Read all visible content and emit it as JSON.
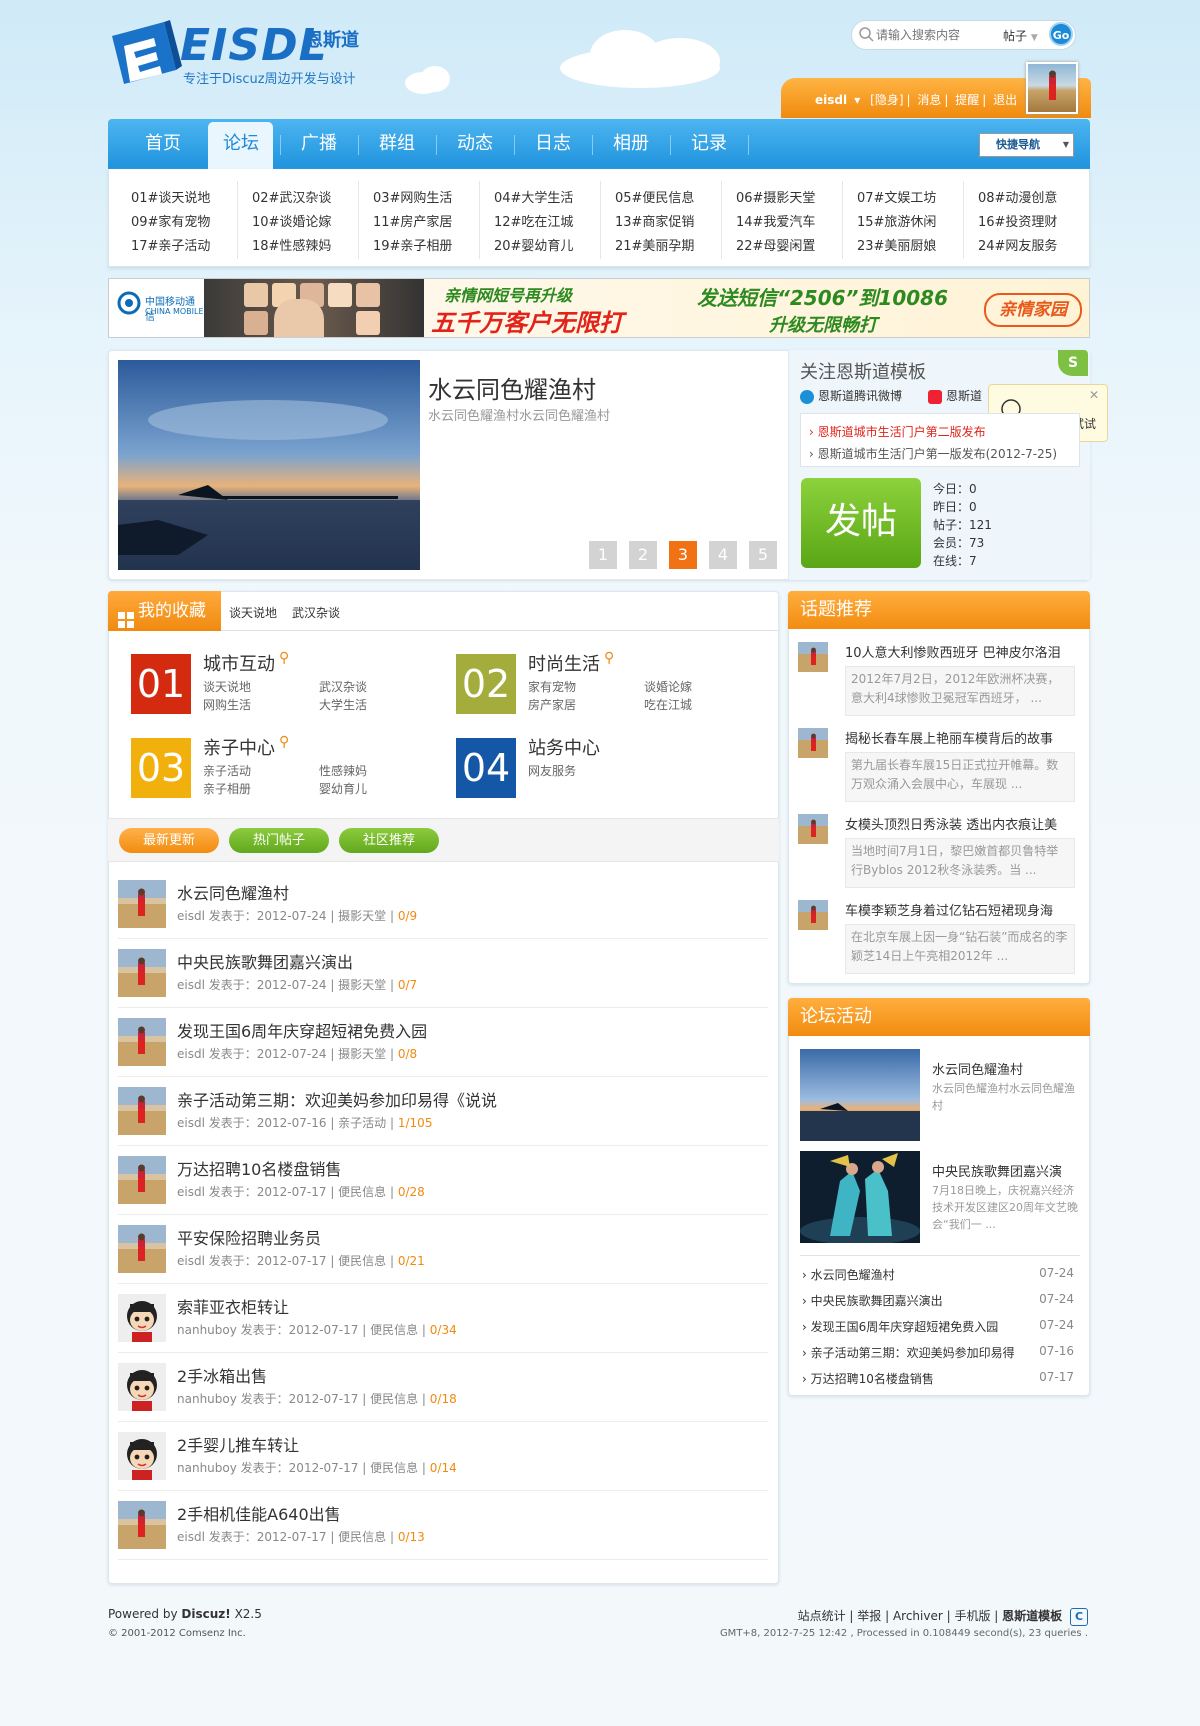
{
  "header": {
    "logo_text": "EISDL",
    "logo_cn": "恩斯道",
    "slogan": "专注于Discuz周边开发与设计",
    "search_placeholder": "请输入搜索内容",
    "search_type": "帖子",
    "search_button": "Go"
  },
  "userbar": {
    "username": "eisdl",
    "links": [
      "[隐身]",
      "消息",
      "提醒",
      "退出"
    ]
  },
  "nav": {
    "items": [
      "首页",
      "论坛",
      "广播",
      "群组",
      "动态",
      "日志",
      "相册",
      "记录"
    ],
    "active": "论坛",
    "quick_nav": "快捷导航"
  },
  "forums": [
    [
      "01#谈天说地",
      "02#武汉杂谈",
      "03#网购生活",
      "04#大学生活",
      "05#便民信息",
      "06#摄影天堂",
      "07#文娱工坊",
      "08#动漫创意"
    ],
    [
      "09#家有宠物",
      "10#谈婚论嫁",
      "11#房产家居",
      "12#吃在江城",
      "13#商家促销",
      "14#我爱汽车",
      "15#旅游休闲",
      "16#投资理财"
    ],
    [
      "17#亲子活动",
      "18#性感辣妈",
      "19#亲子相册",
      "20#婴幼育儿",
      "21#美丽孕期",
      "22#母婴闲置",
      "23#美丽厨娘",
      "24#网友服务"
    ]
  ],
  "banner": {
    "brand": "中国移动通信",
    "brand_en": "CHINA MOBILE",
    "slogan1": "亲情网短号再升级",
    "slogan2": "五千万客户无限打",
    "slogan3": "发送短信“2506”到10086",
    "slogan4": "升级无限畅打",
    "logo": "亲情家园"
  },
  "slider": {
    "title": "水云同色耀渔村",
    "desc": "水云同色耀渔村水云同色耀渔村",
    "pages": [
      "1",
      "2",
      "3",
      "4",
      "5"
    ],
    "active_page": "3"
  },
  "follow": {
    "title": "关注恩斯道模板",
    "weibo1": "恩斯道腾讯微博",
    "weibo2": "恩斯道",
    "tip": "点一下试试",
    "news": [
      "恩斯道城市生活门户第二版发布",
      "恩斯道城市生活门户第一版发布(2012-7-25)"
    ],
    "post_button": "发帖",
    "stats": [
      "今日：0",
      "昨日：0",
      "帖子：121",
      "会员：73",
      "在线：7"
    ]
  },
  "favorites": {
    "tab": "我的收藏",
    "links": [
      "谈天说地",
      "武汉杂谈"
    ],
    "categories": [
      {
        "num": "01",
        "title": "城市互动",
        "subs": [
          "谈天说地",
          "武汉杂谈",
          "网购生活",
          "大学生活"
        ],
        "color": "#d42a0f"
      },
      {
        "num": "02",
        "title": "时尚生活",
        "subs": [
          "家有宠物",
          "谈婚论嫁",
          "房产家居",
          "吃在江城"
        ],
        "color": "#a4ad3c"
      },
      {
        "num": "03",
        "title": "亲子中心",
        "subs": [
          "亲子活动",
          "性感辣妈",
          "亲子相册",
          "婴幼育儿"
        ],
        "color": "#f2b00c"
      },
      {
        "num": "04",
        "title": "站务中心",
        "subs": [
          "网友服务"
        ],
        "color": "#1457a6"
      }
    ]
  },
  "thread_tabs": [
    "最新更新",
    "热门帖子",
    "社区推荐"
  ],
  "threads": [
    {
      "title": "水云同色耀渔村",
      "author": "eisdl",
      "posted": "发表于：2012-07-24",
      "forum": "摄影天堂",
      "replies": "0",
      "views": "/9",
      "avatar": "photo"
    },
    {
      "title": "中央民族歌舞团嘉兴演出",
      "author": "eisdl",
      "posted": "发表于：2012-07-24",
      "forum": "摄影天堂",
      "replies": "0",
      "views": "/7",
      "avatar": "photo"
    },
    {
      "title": "发现王国6周年庆穿超短裙免费入园",
      "author": "eisdl",
      "posted": "发表于：2012-07-24",
      "forum": "摄影天堂",
      "replies": "0",
      "views": "/8",
      "avatar": "photo"
    },
    {
      "title": "亲子活动第三期：欢迎美妈参加印易得《说说",
      "author": "eisdl",
      "posted": "发表于：2012-07-16",
      "forum": "亲子活动",
      "replies": "1",
      "views": "/105",
      "avatar": "photo"
    },
    {
      "title": "万达招聘10名楼盘销售",
      "author": "eisdl",
      "posted": "发表于：2012-07-17",
      "forum": "便民信息",
      "replies": "0",
      "views": "/28",
      "avatar": "photo"
    },
    {
      "title": "平安保险招聘业务员",
      "author": "eisdl",
      "posted": "发表于：2012-07-17",
      "forum": "便民信息",
      "replies": "0",
      "views": "/21",
      "avatar": "photo"
    },
    {
      "title": "索菲亚衣柜转让",
      "author": "nanhuboy",
      "posted": "发表于：2012-07-17",
      "forum": "便民信息",
      "replies": "0",
      "views": "/34",
      "avatar": "cartoon"
    },
    {
      "title": "2手冰箱出售",
      "author": "nanhuboy",
      "posted": "发表于：2012-07-17",
      "forum": "便民信息",
      "replies": "0",
      "views": "/18",
      "avatar": "cartoon"
    },
    {
      "title": "2手婴儿推车转让",
      "author": "nanhuboy",
      "posted": "发表于：2012-07-17",
      "forum": "便民信息",
      "replies": "0",
      "views": "/14",
      "avatar": "cartoon"
    },
    {
      "title": "2手相机佳能A640出售",
      "author": "eisdl",
      "posted": "发表于：2012-07-17",
      "forum": "便民信息",
      "replies": "0",
      "views": "/13",
      "avatar": "photo"
    }
  ],
  "topics": {
    "title": "话题推荐",
    "items": [
      {
        "title": "10人意大利惨败西班牙 巴神皮尔洛泪",
        "desc": "2012年7月2日，2012年欧洲杯决赛，意大利4球惨败卫冕冠军西班牙， ..."
      },
      {
        "title": "揭秘长春车展上艳丽车模背后的故事",
        "desc": "第九届长春车展15日正式拉开帷幕。数万观众涌入会展中心，车展现 ..."
      },
      {
        "title": "女模头顶烈日秀泳装 透出内衣痕让美",
        "desc": "当地时间7月1日，黎巴嫩首都贝鲁特举行Byblos 2012秋冬泳装秀。当 ..."
      },
      {
        "title": "车模李颖芝身着过亿钻石短裙现身海",
        "desc": "在北京车展上因一身“钻石装”而成名的李颖芝14日上午亮相2012年 ..."
      }
    ]
  },
  "activities": {
    "title": "论坛活动",
    "featured": [
      {
        "title": "水云同色耀渔村",
        "desc": "水云同色耀渔村水云同色耀渔村"
      },
      {
        "title": "中央民族歌舞团嘉兴演",
        "desc": "7月18日晚上，庆祝嘉兴经济技术开发区建区20周年文艺晚会“我们一 ..."
      }
    ],
    "list": [
      {
        "title": "水云同色耀渔村",
        "date": "07-24"
      },
      {
        "title": "中央民族歌舞团嘉兴演出",
        "date": "07-24"
      },
      {
        "title": "发现王国6周年庆穿超短裙免费入园",
        "date": "07-24"
      },
      {
        "title": "亲子活动第三期：欢迎美妈参加印易得",
        "date": "07-16"
      },
      {
        "title": "万达招聘10名楼盘销售",
        "date": "07-17"
      }
    ]
  },
  "footer": {
    "powered": "Powered by",
    "product": "Discuz!",
    "version": "X2.5",
    "copyright": "© 2001-2012 Comsenz Inc.",
    "links": [
      "站点统计",
      "举报",
      "Archiver",
      "手机版",
      "恩斯道模板"
    ],
    "info": "GMT+8, 2012-7-25 12:42 , Processed in 0.108449 second(s), 23 queries ."
  }
}
